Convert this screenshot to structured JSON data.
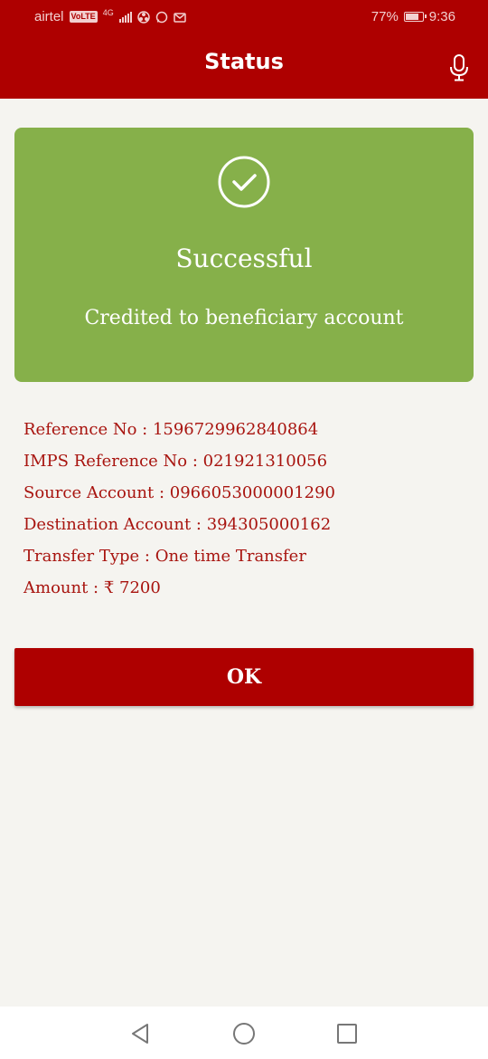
{
  "status_bar": {
    "carrier": "airtel",
    "volte": "VoLTE",
    "network": "4G",
    "battery": "77%",
    "time": "9:36"
  },
  "header": {
    "title": "Status",
    "icon": "microphone-icon"
  },
  "result": {
    "icon": "check-circle-icon",
    "title": "Successful",
    "message": "Credited to beneficiary account",
    "card_color": "#86b04a"
  },
  "details": [
    {
      "label": "Reference No",
      "value": "1596729962840864"
    },
    {
      "label": "IMPS Reference No",
      "value": "021921310056"
    },
    {
      "label": "Source Account",
      "value": "0966053000001290"
    },
    {
      "label": "Destination Account",
      "value": "394305000162"
    },
    {
      "label": "Transfer Type",
      "value": "One time Transfer"
    },
    {
      "label": "Amount",
      "value": "₹ 7200"
    }
  ],
  "ok_button": "OK",
  "colors": {
    "brand": "#ae0000",
    "text_accent": "#a8140f",
    "background": "#f5f4f0"
  },
  "nav": {
    "back": "back-triangle-icon",
    "home": "home-circle-icon",
    "recents": "recents-square-icon"
  }
}
